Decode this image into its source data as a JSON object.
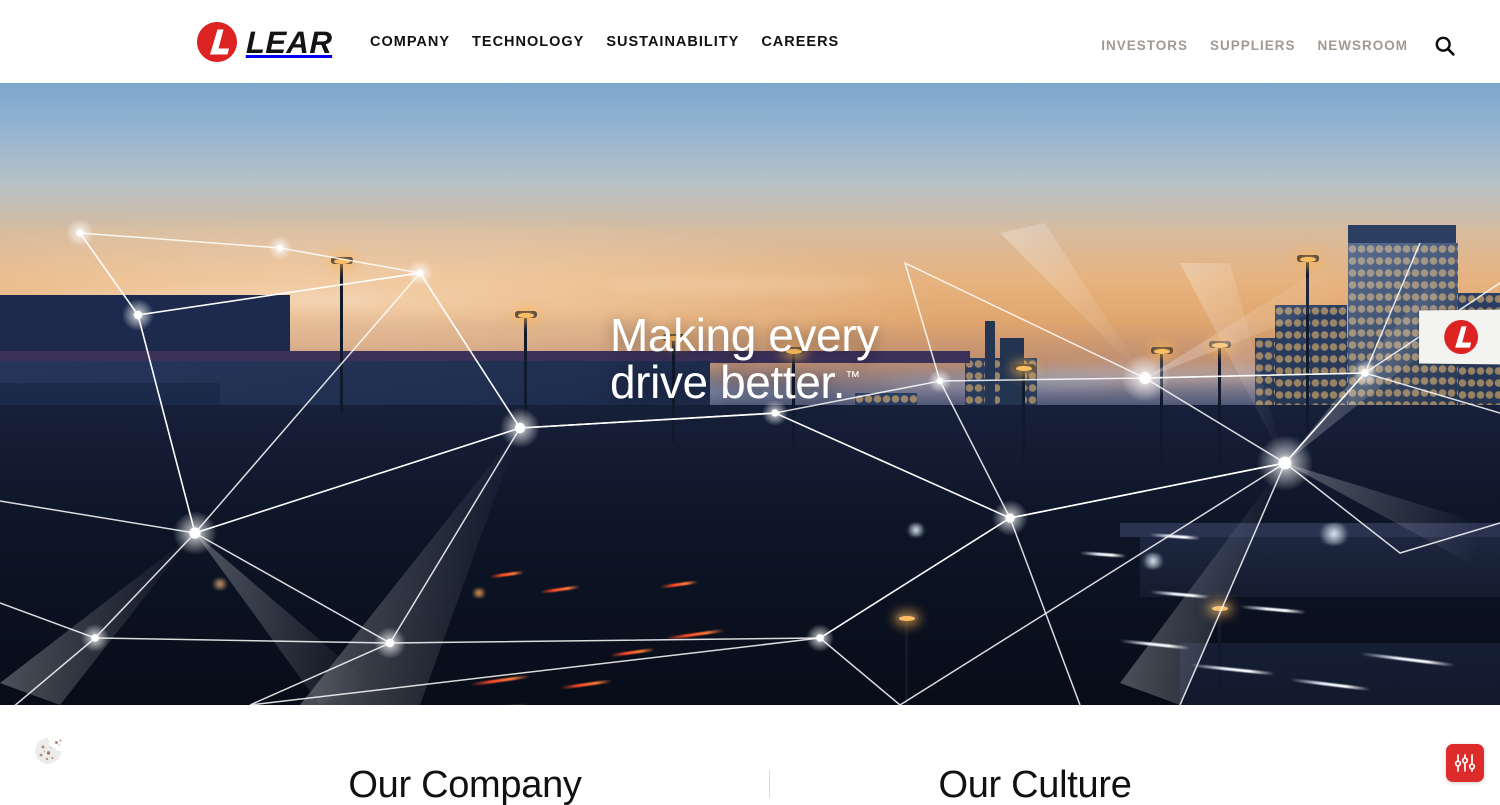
{
  "site": {
    "brand_name": "LEAR",
    "brand_color": "#dd2222",
    "logo_icon": "lear-l-circle-logo"
  },
  "header": {
    "main_nav": [
      {
        "label": "COMPANY"
      },
      {
        "label": "TECHNOLOGY"
      },
      {
        "label": "SUSTAINABILITY"
      },
      {
        "label": "CAREERS"
      }
    ],
    "util_nav": [
      {
        "label": "INVESTORS"
      },
      {
        "label": "SUPPLIERS"
      },
      {
        "label": "NEWSROOM"
      }
    ],
    "search": {
      "icon": "search-icon",
      "label": "Search"
    }
  },
  "hero": {
    "headline_line1": "Making every",
    "headline_line2": "drive better.",
    "trademark": "™",
    "billboard_icon": "lear-l-circle-logo",
    "image_alt": "Night highway interchange with city skyline at dusk and glowing network node overlay"
  },
  "content": {
    "card_left": "Our Company",
    "card_right": "Our Culture"
  },
  "widgets": {
    "cookie": {
      "icon": "cookie-icon",
      "label": "Cookie preferences"
    },
    "preferences": {
      "icon": "sliders-icon",
      "label": "Accessibility preferences",
      "color": "#dd2b2b"
    }
  }
}
